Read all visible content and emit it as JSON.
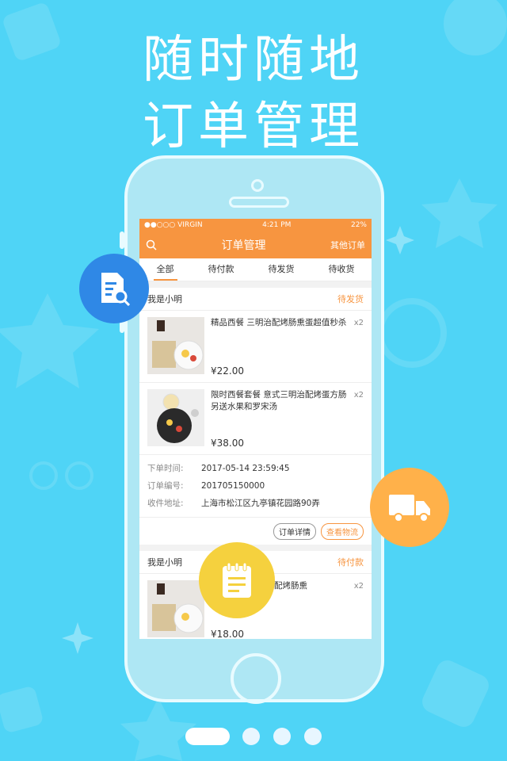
{
  "headline": {
    "line1": "随时随地",
    "line2": "订单管理"
  },
  "status_bar": {
    "carrier": "●●○○○ VIRGIN",
    "time": "4:21 PM",
    "battery": "22%"
  },
  "nav": {
    "title": "订单管理",
    "right": "其他订单"
  },
  "tabs": [
    {
      "label": "全部"
    },
    {
      "label": "待付款"
    },
    {
      "label": "待发货"
    },
    {
      "label": "待收货"
    }
  ],
  "orders": [
    {
      "user": "我是小明",
      "status": "待发货",
      "items": [
        {
          "name": "精品西餐 三明治配烤肠熏蛋超值秒杀",
          "qty": "x2",
          "price": "¥22.00"
        },
        {
          "name": "限时西餐套餐 意式三明治配烤蛋方肠 另送水果和罗宋汤",
          "qty": "x2",
          "price": "¥38.00"
        }
      ],
      "meta": [
        {
          "k": "下单时间:",
          "v": "2017-05-14  23:59:45"
        },
        {
          "k": "订单编号:",
          "v": "201705150000"
        },
        {
          "k": "收件地址:",
          "v": "上海市松江区九亭镇花园路90弄"
        }
      ],
      "actions": {
        "detail": "订单详情",
        "logistics": "查看物流"
      }
    },
    {
      "user": "我是小明",
      "status": "待付款",
      "items": [
        {
          "name": "配烤肠熏",
          "qty": "x2",
          "price": "¥18.00"
        }
      ]
    }
  ],
  "icons": {
    "search": "search-icon",
    "doc_bubble": "document-search-icon",
    "truck_bubble": "truck-icon",
    "note_bubble": "notepad-icon"
  },
  "colors": {
    "background": "#4fd4f6",
    "accent": "#f79540",
    "blue": "#2f88e6",
    "yellow": "#f5d13e",
    "orange_bubble": "#ffb14a"
  },
  "pager": {
    "pages": 4,
    "active": 1
  }
}
